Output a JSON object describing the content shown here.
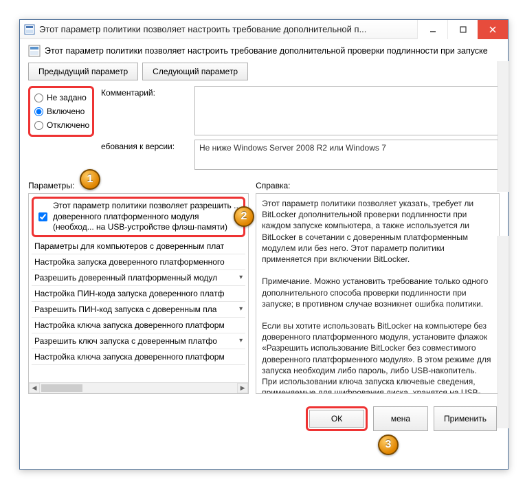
{
  "window": {
    "title": "Этот параметр политики позволяет настроить требование дополнительной п..."
  },
  "header": {
    "text": "Этот параметр политики позволяет настроить требование дополнительной проверки подлинности при запуске"
  },
  "nav": {
    "prev": "Предыдущий параметр",
    "next": "Следующий параметр"
  },
  "state": {
    "not_configured": "Не задано",
    "enabled": "Включено",
    "disabled": "Отключено",
    "selected": "enabled"
  },
  "comment": {
    "label": "Комментарий:",
    "value": ""
  },
  "version": {
    "label": "ебования к версии:",
    "value": "Не ниже Windows Server 2008 R2 или Windows 7"
  },
  "params": {
    "label": "Параметры:",
    "checkbox_text": "Этот параметр политики позволяет разрешить ... доверенного платформенного модуля (необход... на USB-устройстве флэш-памяти)",
    "checkbox_checked": true,
    "lines": [
      "Параметры для компьютеров с доверенным плат",
      "Настройка запуска доверенного платформенного",
      "Разрешить доверенный платформенный модул",
      "Настройка ПИН-кода запуска доверенного платф",
      "Разрешить ПИН-код запуска с доверенным пла",
      "Настройка ключа запуска доверенного платформ",
      "Разрешить ключ запуска с доверенным платфо",
      "Настройка ключа запуска доверенного платформ"
    ]
  },
  "help": {
    "label": "Справка:",
    "p1": "Этот параметр политики позволяет указать, требует ли BitLocker дополнительной проверки подлинности при каждом запуске компьютера, а также используется ли BitLocker в сочетании с доверенным платформенным модулем или без него. Этот параметр политики применяется при включении BitLocker.",
    "p2": "Примечание. Можно установить требование только одного дополнительного способа проверки подлинности при запуске; в противном случае возникнет ошибка политики.",
    "p3": "Если вы хотите использовать BitLocker на компьютере без доверенного платформенного модуля, установите флажок «Разрешить использование BitLocker без совместимого доверенного платформенного модуля». В этом режиме для запуска необходим либо пароль, либо USB-накопитель. При использовании ключа запуска ключевые сведения, применяемые для шифрования диска, хранятся на USB-"
  },
  "actions": {
    "ok": "ОК",
    "cancel": "мена",
    "apply": "Применить"
  },
  "markers": {
    "m1": "1",
    "m2": "2",
    "m3": "3"
  }
}
